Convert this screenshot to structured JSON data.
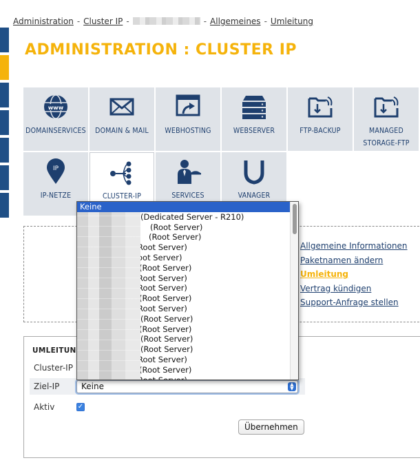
{
  "breadcrumb": {
    "items": [
      "Administration",
      "Cluster IP",
      "Allgemeines",
      "Umleitung"
    ],
    "separator": "-"
  },
  "page_title": "ADMINISTRATION : CLUSTER IP",
  "tiles_row1": [
    {
      "label": "DOMAINSERVICES",
      "icon": "globe-www-icon"
    },
    {
      "label": "DOMAIN & MAIL",
      "icon": "envelope-icon"
    },
    {
      "label": "WEBHOSTING",
      "icon": "browser-upload-icon"
    },
    {
      "label": "WEBSERVER",
      "icon": "server-stack-icon"
    },
    {
      "label": "FTP-BACKUP",
      "icon": "folder-download-icon"
    },
    {
      "label": "MANAGED STORAGE-FTP",
      "icon": "folder-download-icon"
    }
  ],
  "tiles_row2": [
    {
      "label": "IP-NETZE",
      "icon": "ip-pin-icon"
    },
    {
      "label": "CLUSTER-IP",
      "icon": "cluster-nodes-icon",
      "active": true
    },
    {
      "label": "SERVICES",
      "icon": "waiter-icon"
    },
    {
      "label": "VANAGER",
      "icon": "vanager-v-icon"
    }
  ],
  "side_links": [
    {
      "label": "Allgemeine Informationen"
    },
    {
      "label": "Paketnamen ändern"
    },
    {
      "label": "Umleitung",
      "current": true
    },
    {
      "label": "Vertrag kündigen"
    },
    {
      "label": "Support-Anfrage stellen"
    }
  ],
  "form": {
    "title": "UMLEITUNG",
    "cluster_ip_label": "Cluster-IP",
    "ziel_ip_label": "Ziel-IP",
    "ziel_ip_value": "Keine",
    "aktiv_label": "Aktiv",
    "aktiv_checked": true,
    "submit_label": "Übernehmen"
  },
  "dropdown": {
    "options": [
      "Keine",
      "(Dedicated Server - R210)",
      "(Root Server)",
      "(Root Server)",
      "Root Server)",
      "oot Server)",
      "(Root Server)",
      "Root Server)",
      "Root Server)",
      "(Root Server)",
      "Root Server)",
      "(Root Server)",
      "(Root Server)",
      "(Root Server)",
      "(Root Server)",
      "Root Server)",
      "(Root Server)",
      "Root Server)"
    ],
    "selected_index": 0
  },
  "colors": {
    "accent": "#f5b30b",
    "nav_text": "#1e3f6e",
    "tile_bg": "#dfe3e8",
    "selection": "#2a62c9"
  }
}
